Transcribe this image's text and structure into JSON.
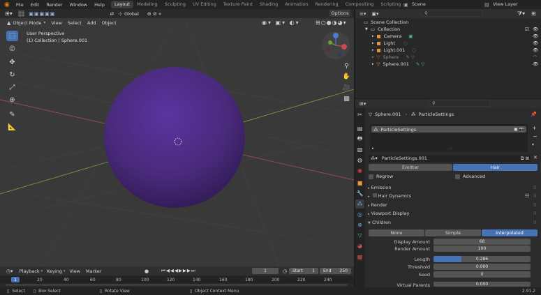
{
  "menu": [
    "File",
    "Edit",
    "Render",
    "Window",
    "Help"
  ],
  "workspaces": [
    "Layout",
    "Modeling",
    "Sculpting",
    "UV Editing",
    "Texture Paint",
    "Shading",
    "Animation",
    "Rendering",
    "Compositing",
    "Scripting"
  ],
  "scene": "Scene",
  "view_layer": "View Layer",
  "toolbar": {
    "orientation": "Global",
    "options": "Options"
  },
  "viewport_header": {
    "mode": "Object Mode",
    "view": "View",
    "select": "Select",
    "add": "Add",
    "object": "Object"
  },
  "viewport_info": {
    "title": "User Perspective",
    "subtitle": "(1) Collection | Sphere.001"
  },
  "outliner": {
    "scene_collection": "Scene Collection",
    "collection": "Collection",
    "items": [
      "Camera",
      "Light",
      "Light.001",
      "Sphere",
      "Sphere.001"
    ]
  },
  "properties": {
    "object": "Sphere.001",
    "psys": "ParticleSettings",
    "list_item": "ParticleSettings",
    "settings_name": "ParticleSettings.001",
    "emitter": "Emitter",
    "hair": "Hair",
    "regrow": "Regrow",
    "advanced": "Advanced",
    "sections": [
      "Emission",
      "Hair Dynamics",
      "Render",
      "Viewport Display",
      "Children"
    ],
    "children_modes": [
      "None",
      "Simple",
      "Interpolated"
    ],
    "display_amount_label": "Display Amount",
    "display_amount": "68",
    "render_amount_label": "Render Amount",
    "render_amount": "100",
    "length_label": "Length",
    "length": "0.286",
    "length_fraction": 0.286,
    "threshold_label": "Threshold",
    "threshold": "0.000",
    "seed_label": "Seed",
    "seed": "0",
    "virtual_parents_label": "Virtual Parents",
    "virtual_parents": "0.000"
  },
  "timeline": {
    "playback": "Playback",
    "keying": "Keying",
    "view": "View",
    "marker": "Marker",
    "current_frame": "1",
    "start_label": "Start",
    "start": "1",
    "end_label": "End",
    "end": "250",
    "ticks": [
      "1",
      "20",
      "40",
      "60",
      "80",
      "100",
      "120",
      "140",
      "160",
      "180",
      "200",
      "220",
      "240"
    ]
  },
  "status": {
    "select": "Select",
    "box_select": "Box Select",
    "rotate": "Rotate View",
    "context": "Object Context Menu",
    "version": "2.91.2"
  },
  "colors": {
    "accent": "#4772b3",
    "sphere": "#4a2a7c",
    "x_axis": "#a3494f",
    "y_axis": "#6f9a3a"
  }
}
